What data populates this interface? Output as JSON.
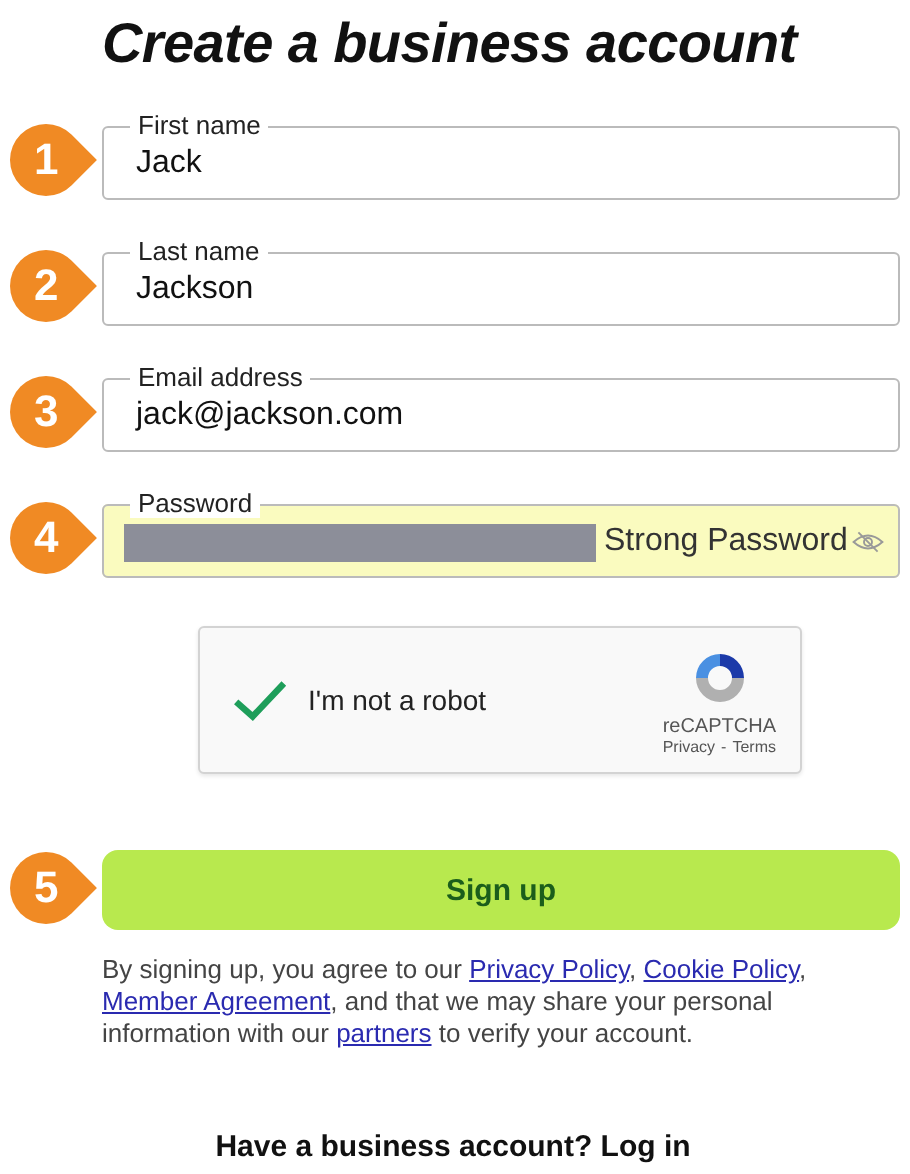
{
  "title": "Create a business account",
  "fields": [
    {
      "step": "1",
      "label": "First name",
      "value": "Jack",
      "kind": "text",
      "highlighted": false
    },
    {
      "step": "2",
      "label": "Last name",
      "value": "Jackson",
      "kind": "text",
      "highlighted": false
    },
    {
      "step": "3",
      "label": "Email address",
      "value": "jack@jackson.com",
      "kind": "text",
      "highlighted": false
    },
    {
      "step": "4",
      "label": "Password",
      "kind": "password",
      "strength": "Strong Password",
      "highlighted": true
    }
  ],
  "captcha": {
    "checked": true,
    "label": "I'm not a robot",
    "brand": "reCAPTCHA",
    "privacy": "Privacy",
    "separator": "-",
    "terms": "Terms"
  },
  "signup": {
    "step": "5",
    "label": "Sign up"
  },
  "legal": [
    {
      "kind": "text",
      "text": "By signing up, you agree to our "
    },
    {
      "kind": "link",
      "text": "Privacy Policy"
    },
    {
      "kind": "text",
      "text": ", "
    },
    {
      "kind": "link",
      "text": "Cookie Policy"
    },
    {
      "kind": "text",
      "text": ", "
    },
    {
      "kind": "link",
      "text": "Member Agreement"
    },
    {
      "kind": "text",
      "text": ", and that we may share your personal information with our "
    },
    {
      "kind": "link",
      "text": "partners"
    },
    {
      "kind": "text",
      "text": " to verify your account."
    }
  ],
  "login_prompt": "Have a business account? Log in"
}
